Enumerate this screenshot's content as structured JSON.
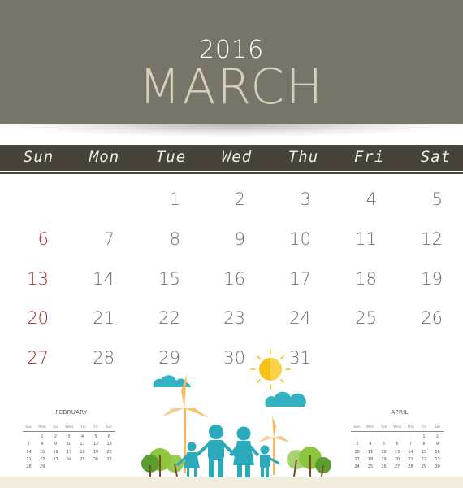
{
  "header": {
    "year": "2016",
    "month": "MARCH"
  },
  "weekdays": [
    "Sun",
    "Mon",
    "Tue",
    "Wed",
    "Thu",
    "Fri",
    "Sat"
  ],
  "main_calendar": {
    "weeks": [
      [
        "",
        "",
        "1",
        "2",
        "3",
        "4",
        "5"
      ],
      [
        "6",
        "7",
        "8",
        "9",
        "10",
        "11",
        "12"
      ],
      [
        "13",
        "14",
        "15",
        "16",
        "17",
        "18",
        "19"
      ],
      [
        "20",
        "21",
        "22",
        "23",
        "24",
        "25",
        "26"
      ],
      [
        "27",
        "28",
        "29",
        "30",
        "31",
        "",
        ""
      ]
    ],
    "sunday_color": "#a52a2f",
    "day_color": "#6d6d6d"
  },
  "prev_month": {
    "title": "FEBRUARY",
    "weekdays": [
      "Sun",
      "Mon",
      "Tue",
      "Wed",
      "Thu",
      "Fri",
      "Sat"
    ],
    "weeks": [
      [
        "",
        "1",
        "2",
        "3",
        "4",
        "5",
        "6"
      ],
      [
        "7",
        "8",
        "9",
        "10",
        "11",
        "12",
        "13"
      ],
      [
        "14",
        "15",
        "16",
        "17",
        "18",
        "19",
        "20"
      ],
      [
        "21",
        "22",
        "23",
        "24",
        "25",
        "26",
        "27"
      ],
      [
        "28",
        "29",
        "",
        "",
        "",
        "",
        ""
      ]
    ]
  },
  "next_month": {
    "title": "APRIL",
    "weekdays": [
      "Sun",
      "Mon",
      "Tue",
      "Wed",
      "Thu",
      "Fri",
      "Sat"
    ],
    "weeks": [
      [
        "",
        "",
        "",
        "",
        "",
        "1",
        "2"
      ],
      [
        "3",
        "4",
        "5",
        "6",
        "7",
        "8",
        "9"
      ],
      [
        "10",
        "11",
        "12",
        "13",
        "14",
        "15",
        "16"
      ],
      [
        "17",
        "18",
        "19",
        "20",
        "21",
        "22",
        "23"
      ],
      [
        "24",
        "25",
        "26",
        "27",
        "28",
        "29",
        "30"
      ]
    ]
  },
  "illustration": {
    "subject": "family with wind turbines, trees, clouds and sun",
    "colors": {
      "family": "#2aaabb",
      "sun": "#f6c21a",
      "turbine": "#f6b860",
      "tree_light": "#8cc63f",
      "tree_dark": "#5a9e2f",
      "cloud": "#35b2c2",
      "ground": "#f1eee0"
    }
  },
  "colors": {
    "header_bg": "#77756a",
    "dow_bar": "#47433a",
    "month_text": "#d8cfbb"
  }
}
